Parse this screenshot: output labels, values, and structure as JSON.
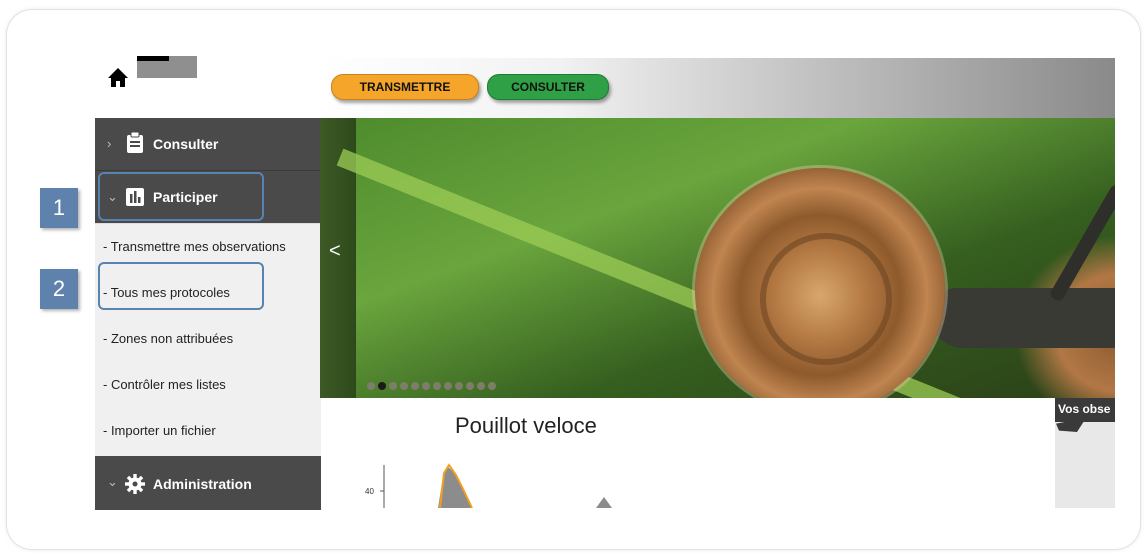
{
  "header": {
    "home_icon": "home-icon",
    "buttons": [
      {
        "label": "TRANSMETTRE",
        "color": "#f5a52a"
      },
      {
        "label": "CONSULTER",
        "color": "#2fa045"
      }
    ]
  },
  "sidebar": {
    "sections": [
      {
        "label": "Consulter",
        "icon": "clipboard-icon",
        "chevron": "›"
      },
      {
        "label": "Participer",
        "icon": "bar-chart-icon",
        "chevron": "⌄"
      },
      {
        "label": "Administration",
        "icon": "gear-icon",
        "chevron": "⌄"
      }
    ],
    "submenu": [
      "- Transmettre mes observations",
      "- Tous mes protocoles",
      "- Zones non attribuées",
      "- Contrôler mes listes",
      "- Importer un fichier"
    ]
  },
  "annotations": [
    "1",
    "2"
  ],
  "carousel": {
    "prev_label": "<",
    "dot_count": 12,
    "active_dot": 1
  },
  "main": {
    "chart_title": "Pouillot veloce",
    "y_tick": "40"
  },
  "right_panel": {
    "title": "Vos obse"
  },
  "colors": {
    "annotation": "#5f82ad",
    "sidebar_dark": "#4a4a4a",
    "sidebar_light": "#f0f0f0"
  }
}
